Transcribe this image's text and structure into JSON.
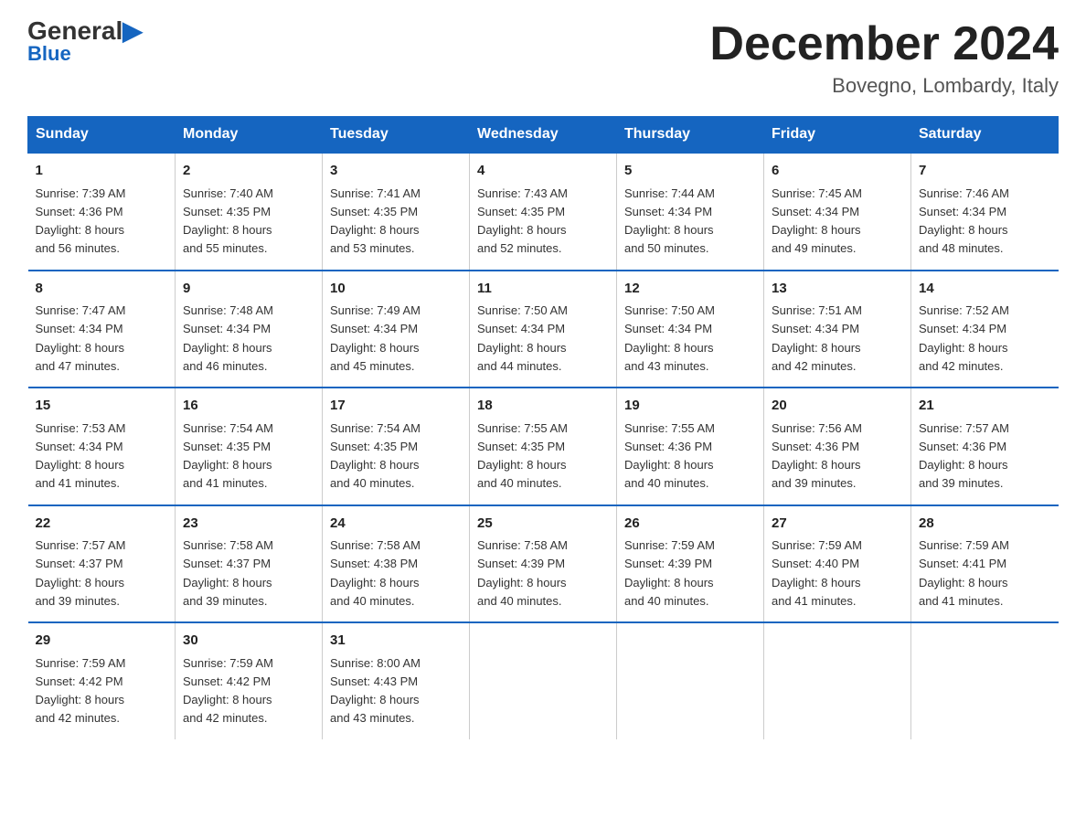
{
  "header": {
    "logo_general": "General",
    "logo_blue": "Blue",
    "month_title": "December 2024",
    "location": "Bovegno, Lombardy, Italy"
  },
  "days_of_week": [
    "Sunday",
    "Monday",
    "Tuesday",
    "Wednesday",
    "Thursday",
    "Friday",
    "Saturday"
  ],
  "weeks": [
    [
      {
        "day": "1",
        "sunrise": "7:39 AM",
        "sunset": "4:36 PM",
        "daylight": "8 hours and 56 minutes."
      },
      {
        "day": "2",
        "sunrise": "7:40 AM",
        "sunset": "4:35 PM",
        "daylight": "8 hours and 55 minutes."
      },
      {
        "day": "3",
        "sunrise": "7:41 AM",
        "sunset": "4:35 PM",
        "daylight": "8 hours and 53 minutes."
      },
      {
        "day": "4",
        "sunrise": "7:43 AM",
        "sunset": "4:35 PM",
        "daylight": "8 hours and 52 minutes."
      },
      {
        "day": "5",
        "sunrise": "7:44 AM",
        "sunset": "4:34 PM",
        "daylight": "8 hours and 50 minutes."
      },
      {
        "day": "6",
        "sunrise": "7:45 AM",
        "sunset": "4:34 PM",
        "daylight": "8 hours and 49 minutes."
      },
      {
        "day": "7",
        "sunrise": "7:46 AM",
        "sunset": "4:34 PM",
        "daylight": "8 hours and 48 minutes."
      }
    ],
    [
      {
        "day": "8",
        "sunrise": "7:47 AM",
        "sunset": "4:34 PM",
        "daylight": "8 hours and 47 minutes."
      },
      {
        "day": "9",
        "sunrise": "7:48 AM",
        "sunset": "4:34 PM",
        "daylight": "8 hours and 46 minutes."
      },
      {
        "day": "10",
        "sunrise": "7:49 AM",
        "sunset": "4:34 PM",
        "daylight": "8 hours and 45 minutes."
      },
      {
        "day": "11",
        "sunrise": "7:50 AM",
        "sunset": "4:34 PM",
        "daylight": "8 hours and 44 minutes."
      },
      {
        "day": "12",
        "sunrise": "7:50 AM",
        "sunset": "4:34 PM",
        "daylight": "8 hours and 43 minutes."
      },
      {
        "day": "13",
        "sunrise": "7:51 AM",
        "sunset": "4:34 PM",
        "daylight": "8 hours and 42 minutes."
      },
      {
        "day": "14",
        "sunrise": "7:52 AM",
        "sunset": "4:34 PM",
        "daylight": "8 hours and 42 minutes."
      }
    ],
    [
      {
        "day": "15",
        "sunrise": "7:53 AM",
        "sunset": "4:34 PM",
        "daylight": "8 hours and 41 minutes."
      },
      {
        "day": "16",
        "sunrise": "7:54 AM",
        "sunset": "4:35 PM",
        "daylight": "8 hours and 41 minutes."
      },
      {
        "day": "17",
        "sunrise": "7:54 AM",
        "sunset": "4:35 PM",
        "daylight": "8 hours and 40 minutes."
      },
      {
        "day": "18",
        "sunrise": "7:55 AM",
        "sunset": "4:35 PM",
        "daylight": "8 hours and 40 minutes."
      },
      {
        "day": "19",
        "sunrise": "7:55 AM",
        "sunset": "4:36 PM",
        "daylight": "8 hours and 40 minutes."
      },
      {
        "day": "20",
        "sunrise": "7:56 AM",
        "sunset": "4:36 PM",
        "daylight": "8 hours and 39 minutes."
      },
      {
        "day": "21",
        "sunrise": "7:57 AM",
        "sunset": "4:36 PM",
        "daylight": "8 hours and 39 minutes."
      }
    ],
    [
      {
        "day": "22",
        "sunrise": "7:57 AM",
        "sunset": "4:37 PM",
        "daylight": "8 hours and 39 minutes."
      },
      {
        "day": "23",
        "sunrise": "7:58 AM",
        "sunset": "4:37 PM",
        "daylight": "8 hours and 39 minutes."
      },
      {
        "day": "24",
        "sunrise": "7:58 AM",
        "sunset": "4:38 PM",
        "daylight": "8 hours and 40 minutes."
      },
      {
        "day": "25",
        "sunrise": "7:58 AM",
        "sunset": "4:39 PM",
        "daylight": "8 hours and 40 minutes."
      },
      {
        "day": "26",
        "sunrise": "7:59 AM",
        "sunset": "4:39 PM",
        "daylight": "8 hours and 40 minutes."
      },
      {
        "day": "27",
        "sunrise": "7:59 AM",
        "sunset": "4:40 PM",
        "daylight": "8 hours and 41 minutes."
      },
      {
        "day": "28",
        "sunrise": "7:59 AM",
        "sunset": "4:41 PM",
        "daylight": "8 hours and 41 minutes."
      }
    ],
    [
      {
        "day": "29",
        "sunrise": "7:59 AM",
        "sunset": "4:42 PM",
        "daylight": "8 hours and 42 minutes."
      },
      {
        "day": "30",
        "sunrise": "7:59 AM",
        "sunset": "4:42 PM",
        "daylight": "8 hours and 42 minutes."
      },
      {
        "day": "31",
        "sunrise": "8:00 AM",
        "sunset": "4:43 PM",
        "daylight": "8 hours and 43 minutes."
      },
      null,
      null,
      null,
      null
    ]
  ],
  "labels": {
    "sunrise": "Sunrise:",
    "sunset": "Sunset:",
    "daylight": "Daylight:"
  }
}
